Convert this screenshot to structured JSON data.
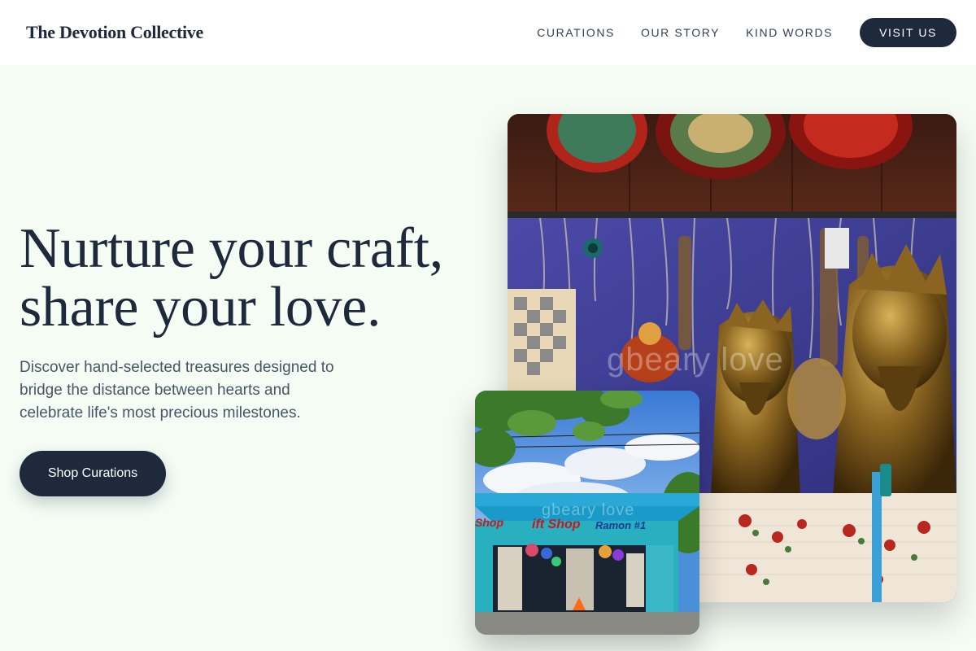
{
  "header": {
    "brand": "The Devotion Collective",
    "nav": [
      "CURATIONS",
      "OUR STORY",
      "KIND WORDS"
    ],
    "cta": "VISIT US"
  },
  "hero": {
    "title_line1": "Nurture your craft,",
    "title_line2": "share your love.",
    "subtitle_line1": "Discover hand-selected treasures designed to",
    "subtitle_line2": "bridge the distance between hearts and",
    "subtitle_line3": "celebrate life's most precious milestones.",
    "button": "Shop Curations"
  },
  "images": {
    "main_watermark": "gbeary love",
    "small_watermark": "gbeary love",
    "shop_sign_left": "Shop",
    "shop_sign_center": "ift Shop",
    "shop_sign_right": "Ramon #1"
  },
  "colors": {
    "background": "#f4fcf4",
    "header": "#ffffff",
    "primary": "#1e293b",
    "text_secondary": "#475569"
  }
}
